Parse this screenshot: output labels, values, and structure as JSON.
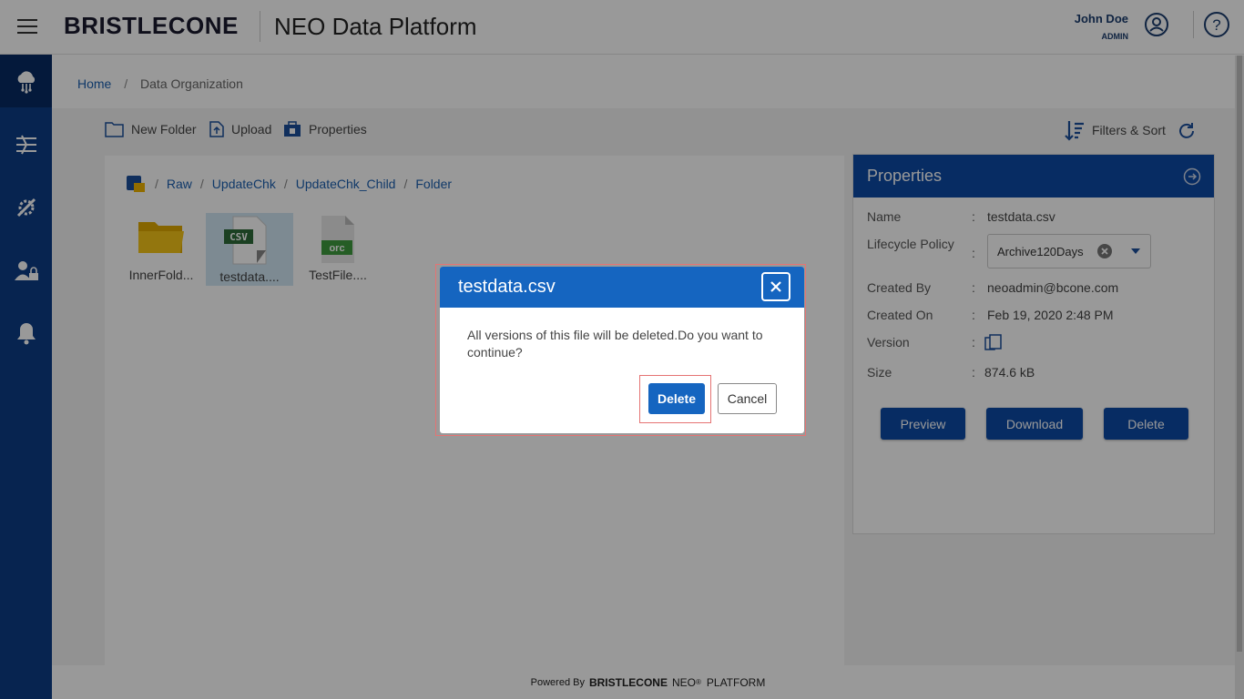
{
  "header": {
    "brand": "BRISTLECONE",
    "app_title": "NEO Data Platform",
    "user_name": "John Doe",
    "user_role": "ADMIN"
  },
  "sidebar": {
    "items": [
      "cloud-data-icon",
      "pipeline-icon",
      "settings-tools-icon",
      "user-admin-icon",
      "notification-bell-icon"
    ]
  },
  "breadcrumb": {
    "home": "Home",
    "separator": "/",
    "current": "Data Organization"
  },
  "toolbar": {
    "new_folder": "New Folder",
    "upload": "Upload",
    "properties": "Properties",
    "filters_sort": "Filters & Sort"
  },
  "path": [
    "Raw",
    "UpdateChk",
    "UpdateChk_Child",
    "Folder"
  ],
  "path_separator": "/",
  "files": [
    {
      "name": "InnerFold...",
      "type": "folder"
    },
    {
      "name": "testdata....",
      "type": "CSV",
      "selected": true
    },
    {
      "name": "TestFile....",
      "type": "orc"
    }
  ],
  "properties": {
    "title": "Properties",
    "colon": ":",
    "name_label": "Name",
    "name_value": "testdata.csv",
    "lifecycle_label": "Lifecycle Policy",
    "lifecycle_value": "Archive120Days",
    "created_by_label": "Created By",
    "created_by_value": "neoadmin@bcone.com",
    "created_on_label": "Created On",
    "created_on_value": "Feb 19, 2020 2:48 PM",
    "version_label": "Version",
    "size_label": "Size",
    "size_value": "874.6 kB",
    "preview_btn": "Preview",
    "download_btn": "Download",
    "delete_btn": "Delete"
  },
  "footer": {
    "powered_by": "Powered By",
    "brand": "BRISTLECONE",
    "neo": "NEO",
    "reg": "®",
    "platform": "PLATFORM"
  },
  "dialog": {
    "title": "testdata.csv",
    "message": "All versions of this file will be deleted.Do you want to continue?",
    "delete_btn": "Delete",
    "cancel_btn": "Cancel"
  },
  "colors": {
    "primary": "#0d4aa6",
    "sidebar": "#0d3c85",
    "dialog_header": "#1565c0",
    "highlight_outline": "#e57373"
  }
}
